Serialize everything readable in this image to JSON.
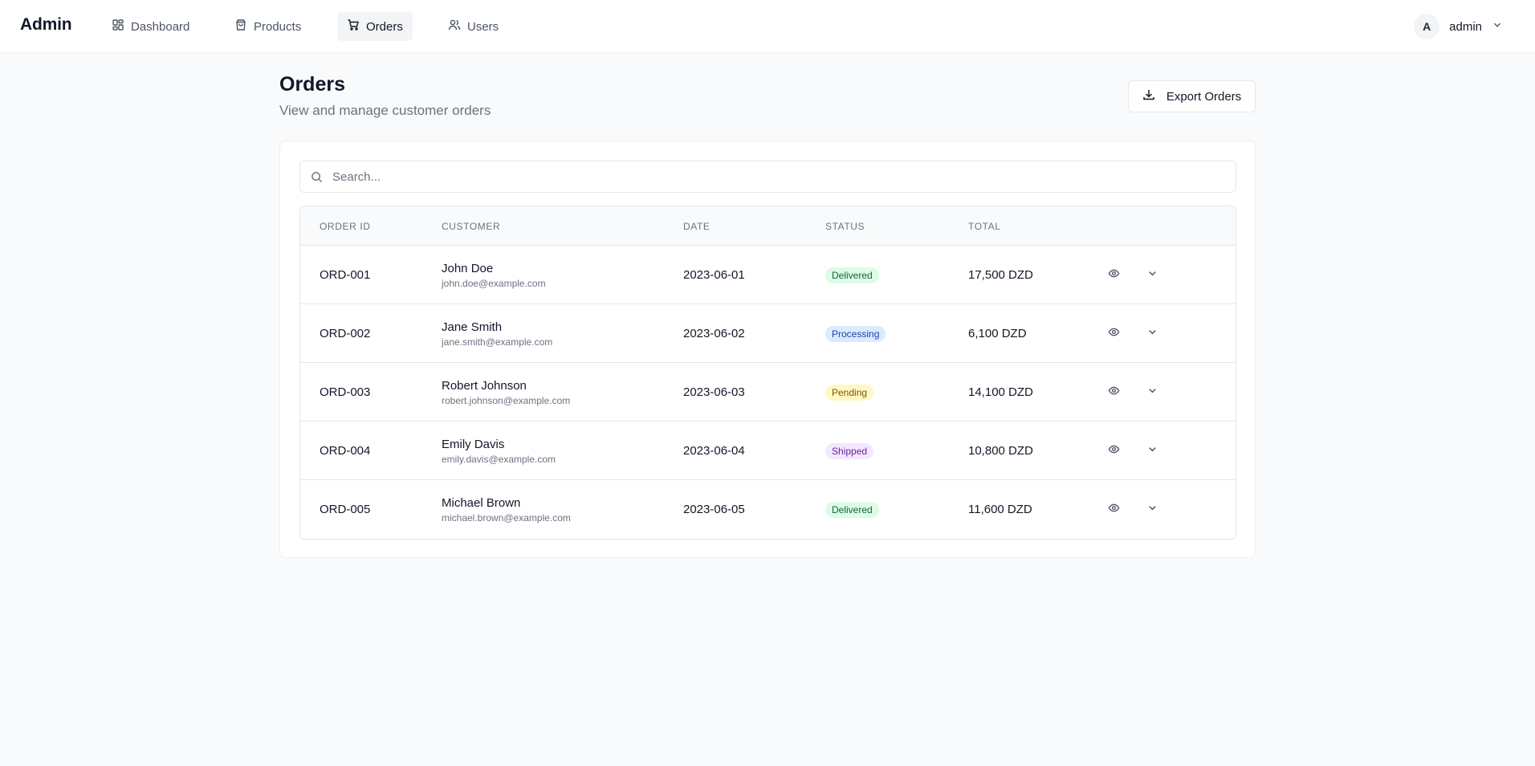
{
  "app": {
    "brand": "Admin"
  },
  "nav": {
    "items": [
      {
        "label": "Dashboard",
        "icon": "dashboard-icon",
        "active": false
      },
      {
        "label": "Products",
        "icon": "shopping-bag-icon",
        "active": false
      },
      {
        "label": "Orders",
        "icon": "cart-icon",
        "active": true
      },
      {
        "label": "Users",
        "icon": "users-icon",
        "active": false
      }
    ]
  },
  "user": {
    "avatar_initial": "A",
    "name": "admin"
  },
  "page": {
    "title": "Orders",
    "subtitle": "View and manage customer orders",
    "export_label": "Export Orders"
  },
  "search": {
    "placeholder": "Search...",
    "value": ""
  },
  "table": {
    "columns": [
      "Order ID",
      "Customer",
      "Date",
      "Status",
      "Total"
    ],
    "rows": [
      {
        "id": "ORD-001",
        "name": "John Doe",
        "email": "john.doe@example.com",
        "date": "2023-06-01",
        "status": "Delivered",
        "total": "17,500 DZD"
      },
      {
        "id": "ORD-002",
        "name": "Jane Smith",
        "email": "jane.smith@example.com",
        "date": "2023-06-02",
        "status": "Processing",
        "total": "6,100 DZD"
      },
      {
        "id": "ORD-003",
        "name": "Robert Johnson",
        "email": "robert.johnson@example.com",
        "date": "2023-06-03",
        "status": "Pending",
        "total": "14,100 DZD"
      },
      {
        "id": "ORD-004",
        "name": "Emily Davis",
        "email": "emily.davis@example.com",
        "date": "2023-06-04",
        "status": "Shipped",
        "total": "10,800 DZD"
      },
      {
        "id": "ORD-005",
        "name": "Michael Brown",
        "email": "michael.brown@example.com",
        "date": "2023-06-05",
        "status": "Delivered",
        "total": "11,600 DZD"
      }
    ]
  },
  "status_colors": {
    "Delivered": {
      "bg": "#dcfce7",
      "fg": "#166534"
    },
    "Processing": {
      "bg": "#dbeafe",
      "fg": "#1e40af"
    },
    "Pending": {
      "bg": "#fef9c3",
      "fg": "#854d0e"
    },
    "Shipped": {
      "bg": "#f3e8ff",
      "fg": "#6b21a8"
    }
  }
}
